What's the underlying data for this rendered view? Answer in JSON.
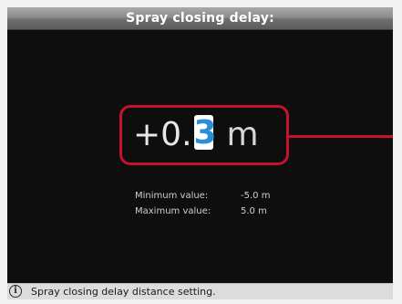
{
  "screen": {
    "title": "Spray closing delay:",
    "value": {
      "prefix": "+0.",
      "active_digit": "3",
      "unit": "m"
    },
    "limits": {
      "minimum_label": "Minimum value:",
      "minimum_value": "-5.0 m",
      "maximum_label": "Maximum value:",
      "maximum_value": "5.0 m"
    },
    "info": {
      "icon": "info-icon",
      "text": "Spray closing delay distance setting."
    }
  },
  "colors": {
    "highlight": "#c4122f",
    "active_digit": "#2a8fd8",
    "background": "#0e0e0e"
  }
}
